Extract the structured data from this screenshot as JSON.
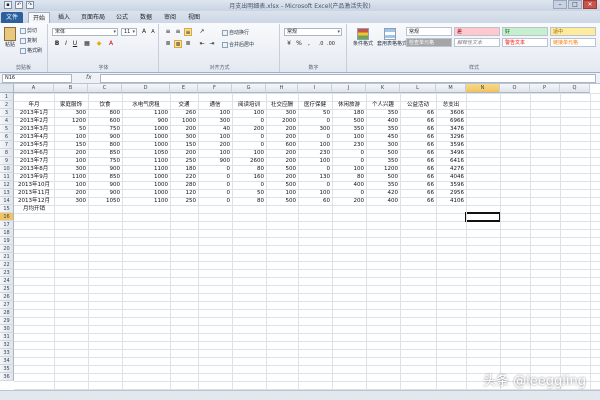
{
  "window": {
    "title": "月支出明细表.xlsx - Microsoft Excel(产品激活失败)",
    "controls": [
      "–",
      "□",
      "✕"
    ]
  },
  "quick_access": [
    "save-icon",
    "undo-icon",
    "redo-icon"
  ],
  "tabs": [
    "文件",
    "开始",
    "插入",
    "页面布局",
    "公式",
    "数据",
    "审阅",
    "视图"
  ],
  "ribbon": {
    "clipboard": {
      "label": "剪贴板",
      "paste": "粘贴",
      "cut": "剪切",
      "copy": "复制",
      "format_painter": "格式刷"
    },
    "font": {
      "label": "字体",
      "font_name": "宋体",
      "font_size": "11"
    },
    "alignment": {
      "label": "对齐方式",
      "wrap": "自动换行",
      "merge": "合并后居中"
    },
    "number": {
      "label": "数字",
      "format": "常规"
    },
    "styles": {
      "label": "样式",
      "conditional": "条件格式",
      "table": "套用表格格式",
      "cells": [
        {
          "text": "常规",
          "bg": "#ffffff",
          "color": "#222222"
        },
        {
          "text": "差",
          "bg": "#ffc7ce",
          "color": "#9c0006"
        },
        {
          "text": "好",
          "bg": "#c6efce",
          "color": "#006100"
        },
        {
          "text": "适中",
          "bg": "#ffeb9c",
          "color": "#9c6500"
        },
        {
          "text": "检查单元格",
          "bg": "#a5a5a5",
          "color": "#ffffff"
        },
        {
          "text": "解释性文本",
          "bg": "#ffffff",
          "color": "#7f7f7f"
        },
        {
          "text": "警告文本",
          "bg": "#ffffff",
          "color": "#ff0000"
        },
        {
          "text": "链接单元格",
          "bg": "#ffffff",
          "color": "#fa7d00"
        }
      ]
    }
  },
  "formula_bar": {
    "name_box": "N16",
    "fx": "fx",
    "value": ""
  },
  "sheet": {
    "columns": [
      "A",
      "B",
      "C",
      "D",
      "E",
      "F",
      "G",
      "H",
      "I",
      "J",
      "K",
      "L",
      "M",
      "N",
      "O",
      "P",
      "Q"
    ],
    "selected_column": "N",
    "selected_row": "16",
    "row_numbers": [
      "1",
      "2",
      "3",
      "4",
      "5",
      "6",
      "7",
      "8",
      "9",
      "10",
      "11",
      "12",
      "13",
      "14",
      "15",
      "16",
      "17",
      "18",
      "19",
      "20",
      "21",
      "22",
      "23",
      "24",
      "25",
      "26",
      "27",
      "28",
      "29",
      "30",
      "31",
      "32",
      "33",
      "34",
      "35",
      "36"
    ],
    "header": [
      "年月",
      "家庭服饰",
      "饮食",
      "水电气房租",
      "交通",
      "通信",
      "阅读培训",
      "社交应酬",
      "医疗保健",
      "休闲旅游",
      "个人兴趣",
      "公益活动",
      "总支出"
    ],
    "rows": [
      [
        "2013年1月",
        "300",
        "800",
        "1100",
        "260",
        "100",
        "100",
        "300",
        "50",
        "180",
        "350",
        "66",
        "3606"
      ],
      [
        "2013年2月",
        "1200",
        "600",
        "900",
        "1000",
        "300",
        "0",
        "2000",
        "0",
        "500",
        "400",
        "66",
        "6966"
      ],
      [
        "2013年3月",
        "50",
        "750",
        "1000",
        "200",
        "40",
        "200",
        "200",
        "300",
        "350",
        "350",
        "66",
        "3476"
      ],
      [
        "2013年4月",
        "100",
        "900",
        "1000",
        "300",
        "100",
        "0",
        "200",
        "0",
        "100",
        "450",
        "66",
        "3296"
      ],
      [
        "2013年5月",
        "150",
        "800",
        "1000",
        "150",
        "200",
        "0",
        "600",
        "100",
        "230",
        "300",
        "66",
        "3596"
      ],
      [
        "2013年6月",
        "200",
        "850",
        "1050",
        "200",
        "100",
        "100",
        "200",
        "230",
        "0",
        "500",
        "66",
        "3496"
      ],
      [
        "2013年7月",
        "100",
        "750",
        "1100",
        "250",
        "900",
        "2600",
        "200",
        "100",
        "0",
        "350",
        "66",
        "6416"
      ],
      [
        "2013年8月",
        "300",
        "900",
        "1100",
        "180",
        "0",
        "80",
        "500",
        "0",
        "100",
        "1200",
        "66",
        "4276"
      ],
      [
        "2013年9月",
        "1100",
        "850",
        "1000",
        "220",
        "0",
        "160",
        "200",
        "130",
        "80",
        "500",
        "66",
        "4046"
      ],
      [
        "2013年10月",
        "100",
        "900",
        "1000",
        "280",
        "0",
        "0",
        "500",
        "0",
        "400",
        "350",
        "66",
        "3596"
      ],
      [
        "2013年11月",
        "200",
        "900",
        "1000",
        "120",
        "0",
        "50",
        "100",
        "100",
        "0",
        "420",
        "66",
        "2956"
      ],
      [
        "2013年12月",
        "300",
        "1050",
        "1100",
        "250",
        "0",
        "80",
        "500",
        "60",
        "200",
        "400",
        "66",
        "4106"
      ]
    ],
    "footer_label": "月均开销"
  },
  "watermark": "头条 @leeggling"
}
